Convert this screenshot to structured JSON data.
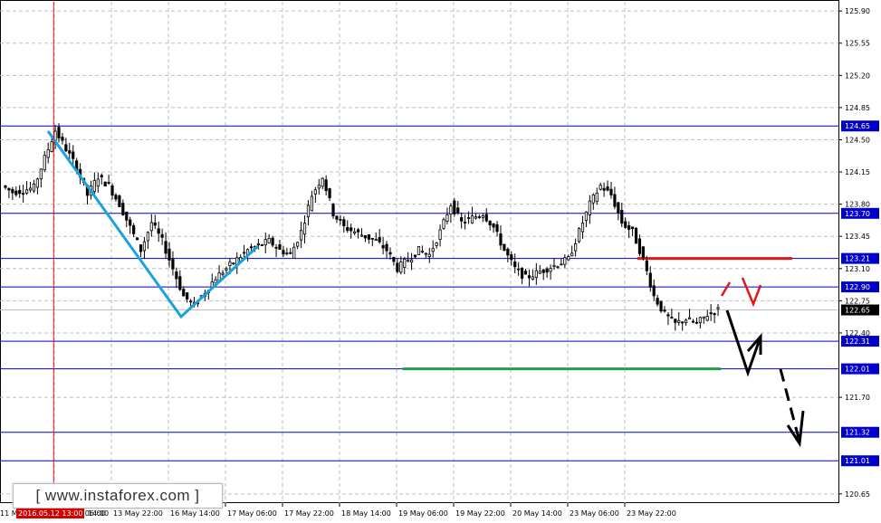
{
  "chart_data": {
    "type": "candlestick",
    "title": "",
    "xlabel": "",
    "ylabel": "",
    "ylim": [
      120.55,
      126.0
    ],
    "grid": true,
    "y_ticks": [
      "125.90",
      "125.55",
      "125.20",
      "124.85",
      "124.50",
      "124.15",
      "123.80",
      "123.45",
      "123.10",
      "122.75",
      "122.40",
      "121.70",
      "120.65"
    ],
    "x_ticks": [
      "11 M",
      "13 May 06:00",
      "13 May 22:00",
      "16 May 14:00",
      "17 May 06:00",
      "17 May 22:00",
      "18 May 14:00",
      "19 May 06:00",
      "19 May 22:00",
      "20 May 14:00",
      "23 May 06:00",
      "23 May 22:00"
    ],
    "x_tick_tail": "14:00",
    "current_price": {
      "label": "122.65",
      "value": 122.65
    },
    "levels": [
      {
        "label": "124.65",
        "value": 124.65
      },
      {
        "label": "123.70",
        "value": 123.7
      },
      {
        "label": "123.21",
        "value": 123.21
      },
      {
        "label": "122.90",
        "value": 122.9
      },
      {
        "label": "122.31",
        "value": 122.31
      },
      {
        "label": "122.01",
        "value": 122.01
      },
      {
        "label": "121.32",
        "value": 121.32
      },
      {
        "label": "121.01",
        "value": 121.01
      }
    ],
    "highlight_lines": [
      {
        "color": "#e01818",
        "value": 123.21,
        "x_from": 0.76,
        "x_to": 0.945
      },
      {
        "color": "#21a043",
        "value": 122.01,
        "x_from": 0.48,
        "x_to": 0.86
      }
    ],
    "close_path": [
      124.0,
      123.93,
      123.95,
      123.98,
      124.3,
      124.6,
      124.4,
      124.2,
      123.9,
      124.1,
      124.0,
      123.8,
      123.55,
      123.3,
      123.6,
      123.4,
      123.1,
      122.8,
      122.7,
      122.85,
      123.0,
      123.1,
      123.2,
      123.3,
      123.35,
      123.4,
      123.3,
      123.25,
      123.5,
      123.9,
      124.1,
      123.7,
      123.55,
      123.5,
      123.45,
      123.4,
      123.3,
      123.1,
      123.2,
      123.3,
      123.25,
      123.5,
      123.8,
      123.6,
      123.65,
      123.7,
      123.55,
      123.3,
      123.1,
      123.0,
      123.05,
      123.1,
      123.15,
      123.2,
      123.5,
      123.8,
      124.0,
      123.9,
      123.6,
      123.5,
      123.2,
      122.8,
      122.6,
      122.5,
      122.55,
      122.5,
      122.6,
      122.65
    ],
    "vertical_marker": {
      "label": "2016.05.12 13:00",
      "x_fraction": 0.064
    }
  },
  "colors": {
    "level": "#0000c8",
    "grid": "#c0c0c0",
    "trend": "#1aa3df",
    "bear_arrow": "#000000",
    "alt_arrow": "#e01818",
    "marker": "#e01818"
  },
  "watermark": "[ www.instaforex.com ]"
}
